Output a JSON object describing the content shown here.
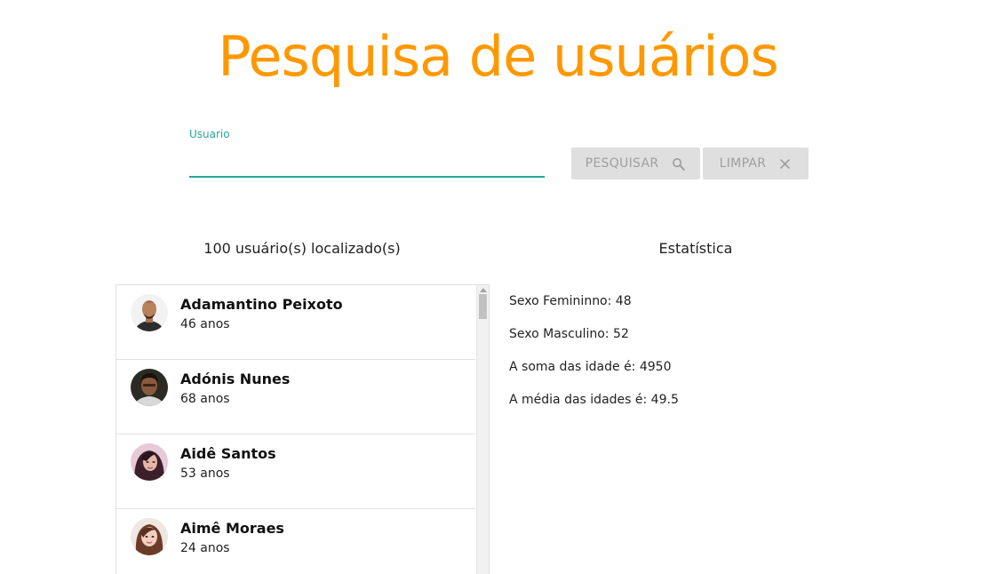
{
  "header": {
    "title": "Pesquisa de usuários"
  },
  "search": {
    "label": "Usuario",
    "value": "",
    "search_button_label": "PESQUISAR",
    "search_button_icon": "search-icon",
    "clear_button_label": "LIMPAR",
    "clear_button_icon": "close-icon"
  },
  "results": {
    "count_text": "100 usuário(s) localizado(s)",
    "users": [
      {
        "name": "Adamantino Peixoto",
        "age": "46 anos"
      },
      {
        "name": "Adónis Nunes",
        "age": "68 anos"
      },
      {
        "name": "Aidê Santos",
        "age": "53 anos"
      },
      {
        "name": "Aimê Moraes",
        "age": "24 anos"
      }
    ]
  },
  "stats": {
    "title": "Estatística",
    "lines": [
      "Sexo Femininno: 48",
      "Sexo Masculino: 52",
      "A soma das idade é: 4950",
      "A média das idades é: 49.5"
    ]
  },
  "colors": {
    "accent": "#ff9800",
    "input_underline": "#26a69a",
    "button_bg": "#dfdfdf",
    "button_text": "#9f9f9f"
  }
}
